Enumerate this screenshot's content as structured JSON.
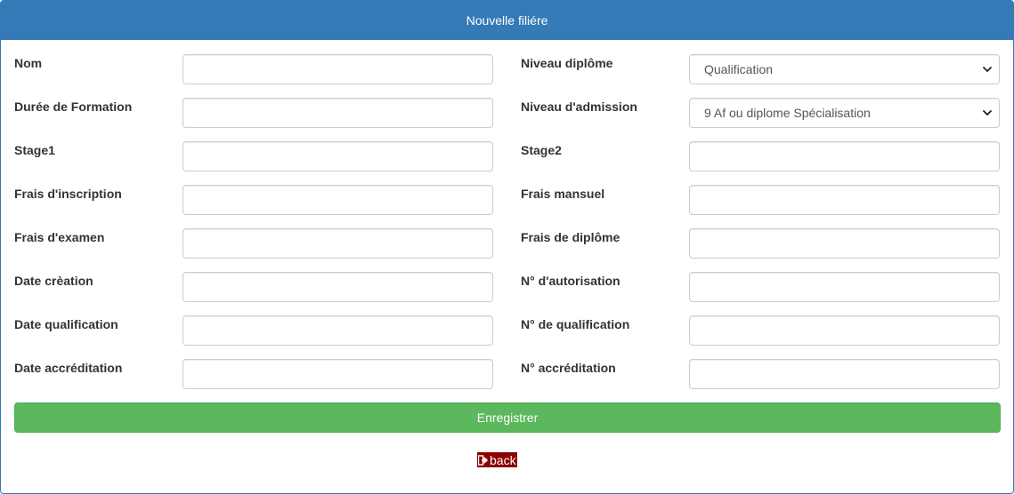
{
  "panel": {
    "title": "Nouvelle filiére"
  },
  "form": {
    "left": [
      {
        "label": "Nom",
        "value": ""
      },
      {
        "label": "Durée de Formation",
        "value": ""
      },
      {
        "label": "Stage1",
        "value": ""
      },
      {
        "label": "Frais d'inscription",
        "value": ""
      },
      {
        "label": "Frais d'examen",
        "value": ""
      },
      {
        "label": "Date crèation",
        "value": ""
      },
      {
        "label": "Date qualification",
        "value": ""
      },
      {
        "label": "Date accréditation",
        "value": ""
      }
    ],
    "right": [
      {
        "label": "Niveau diplôme",
        "selected": "Qualification"
      },
      {
        "label": "Niveau d'admission",
        "selected": "9 Af ou diplome Spécialisation"
      },
      {
        "label": "Stage2",
        "value": ""
      },
      {
        "label": "Frais mansuel",
        "value": ""
      },
      {
        "label": "Frais de diplôme",
        "value": ""
      },
      {
        "label": "N° d'autorisation",
        "value": ""
      },
      {
        "label": "N° de qualification",
        "value": ""
      },
      {
        "label": "N° accréditation",
        "value": ""
      }
    ]
  },
  "actions": {
    "save_label": "Enregistrer",
    "back_label": "back",
    "back_icon": "sign-out-icon"
  },
  "colors": {
    "heading_bg": "#337ab7",
    "save_bg": "#5cb85c",
    "back_bg": "#8b0000"
  }
}
